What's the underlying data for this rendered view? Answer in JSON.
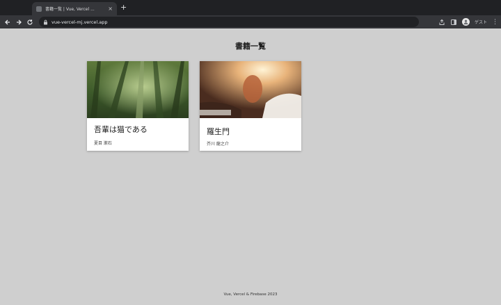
{
  "browser": {
    "tab_title": "書籍一覧 | Vue, Vercel ...",
    "new_tab_label": "+",
    "close_label": "×",
    "url": "vue-vercel-mj.vercel.app",
    "profile_label": "ゲスト",
    "menu_label": "⋮"
  },
  "page": {
    "title": "書籍一覧",
    "books": [
      {
        "title": "吾輩は猫である",
        "author": "夏目 漱石"
      },
      {
        "title": "羅生門",
        "author": "芥川 龍之介"
      }
    ],
    "footer": "Vue, Vercel & Firebase 2023"
  },
  "icons": {
    "back": "arrow-left-icon",
    "forward": "arrow-right-icon",
    "reload": "reload-icon",
    "lock": "lock-icon",
    "share": "share-icon",
    "extensions": "side-panel-icon",
    "profile": "profile-avatar-icon"
  }
}
